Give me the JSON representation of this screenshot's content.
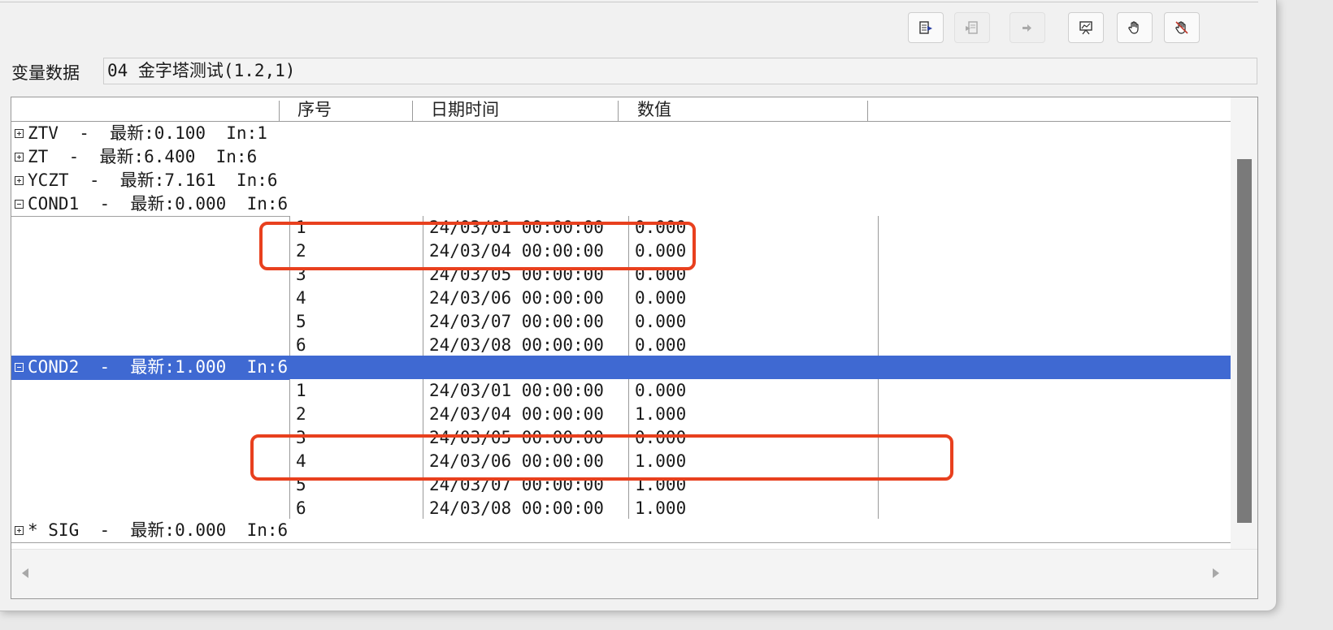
{
  "toolbar": {
    "buttons": [
      {
        "name": "export-icon",
        "enabled": true
      },
      {
        "name": "import-icon",
        "enabled": false
      },
      {
        "name": "arrow-right-icon",
        "enabled": false
      },
      {
        "name": "chart-icon",
        "enabled": true
      },
      {
        "name": "hand-icon",
        "enabled": true
      },
      {
        "name": "hand-cancel-icon",
        "enabled": true
      }
    ]
  },
  "variable": {
    "label": "变量数据",
    "value": "04 金字塔测试(1.2,1)"
  },
  "grid": {
    "columns": [
      "序号",
      "日期时间",
      "数值"
    ],
    "groups": [
      {
        "text": "ZTV  -  最新:0.100  In:1",
        "expanded": false
      },
      {
        "text": "ZT  -  最新:6.400  In:6",
        "expanded": false
      },
      {
        "text": "YCZT  -  最新:7.161  In:6",
        "expanded": false
      },
      {
        "text": "COND1  -  最新:0.000  In:6",
        "expanded": true,
        "rows": [
          {
            "seq": "1",
            "datetime": "24/03/01 00:00:00",
            "value": "0.000"
          },
          {
            "seq": "2",
            "datetime": "24/03/04 00:00:00",
            "value": "0.000"
          },
          {
            "seq": "3",
            "datetime": "24/03/05 00:00:00",
            "value": "0.000"
          },
          {
            "seq": "4",
            "datetime": "24/03/06 00:00:00",
            "value": "0.000"
          },
          {
            "seq": "5",
            "datetime": "24/03/07 00:00:00",
            "value": "0.000"
          },
          {
            "seq": "6",
            "datetime": "24/03/08 00:00:00",
            "value": "0.000"
          }
        ]
      },
      {
        "text": "COND2  -  最新:1.000  In:6",
        "expanded": true,
        "selected": true,
        "rows": [
          {
            "seq": "1",
            "datetime": "24/03/01 00:00:00",
            "value": "0.000"
          },
          {
            "seq": "2",
            "datetime": "24/03/04 00:00:00",
            "value": "1.000"
          },
          {
            "seq": "3",
            "datetime": "24/03/05 00:00:00",
            "value": "0.000"
          },
          {
            "seq": "4",
            "datetime": "24/03/06 00:00:00",
            "value": "1.000"
          },
          {
            "seq": "5",
            "datetime": "24/03/07 00:00:00",
            "value": "1.000"
          },
          {
            "seq": "6",
            "datetime": "24/03/08 00:00:00",
            "value": "1.000"
          }
        ]
      },
      {
        "text": "* SIG  -  最新:0.000  In:6",
        "expanded": false
      }
    ]
  },
  "annotation_color": "#e8401e"
}
